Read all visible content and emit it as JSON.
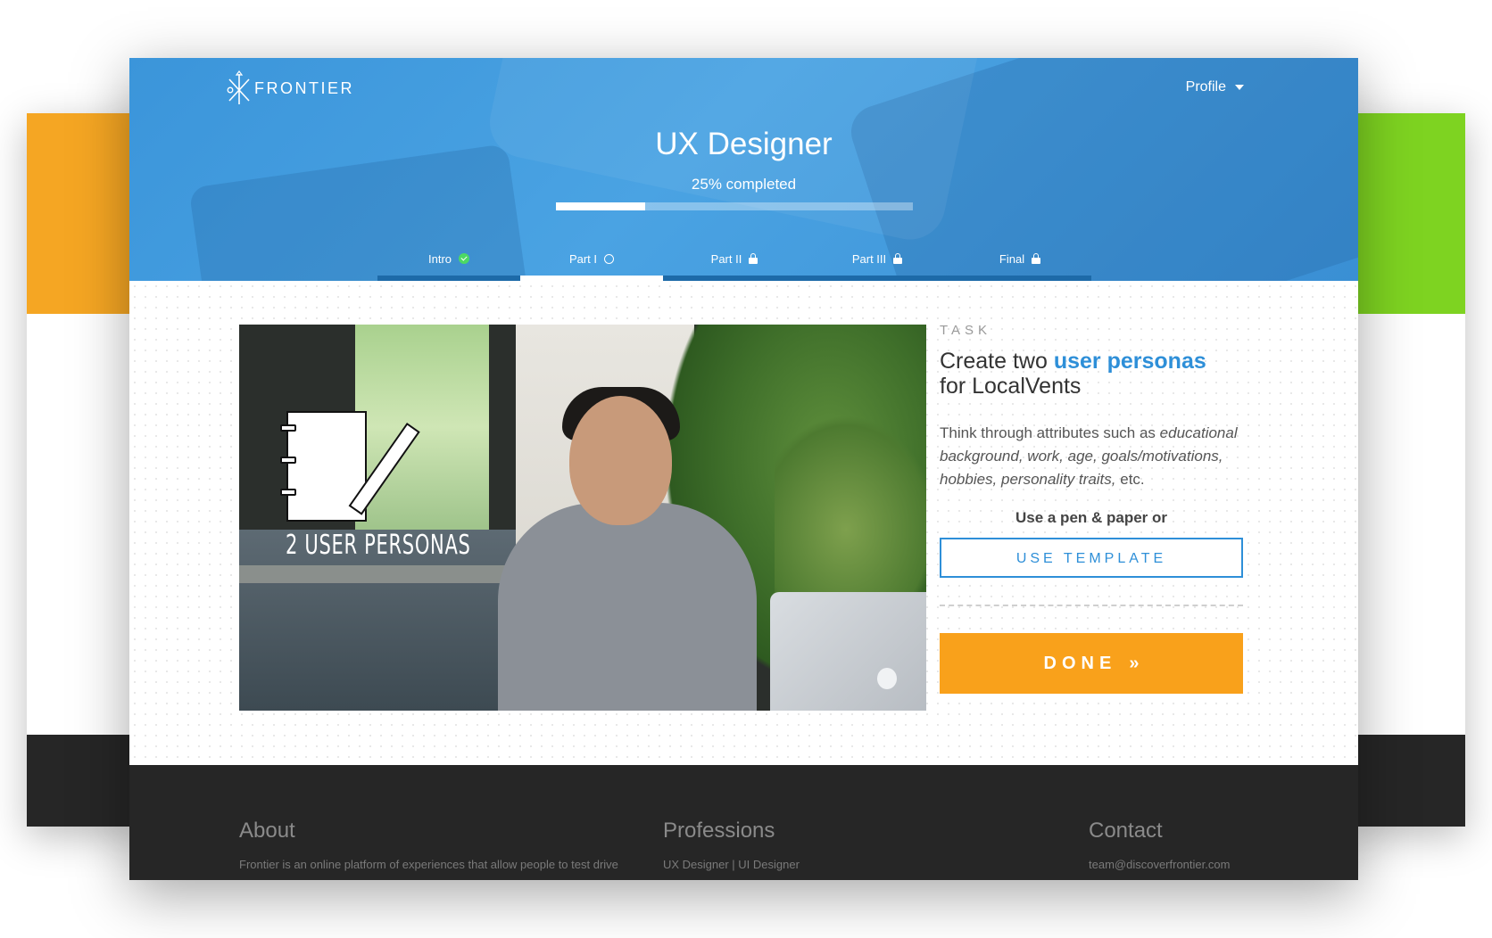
{
  "brand": {
    "name": "FRONTIER"
  },
  "header": {
    "profile_label": "Profile",
    "title": "UX Designer",
    "progress_label": "25% completed",
    "progress_fraction": 0.25
  },
  "steps": [
    {
      "label": "Intro",
      "status": "complete",
      "icon": "check-circle-icon"
    },
    {
      "label": "Part I",
      "status": "active",
      "icon": "circle-icon"
    },
    {
      "label": "Part II",
      "status": "locked",
      "icon": "lock-icon"
    },
    {
      "label": "Part III",
      "status": "locked",
      "icon": "lock-icon"
    },
    {
      "label": "Final",
      "status": "locked",
      "icon": "lock-icon"
    }
  ],
  "video": {
    "caption": "2 USER PERSONAS"
  },
  "task": {
    "label": "TASK",
    "heading_prefix": "Create two",
    "heading_highlight": "user personas",
    "heading_suffix": "for LocalVents",
    "desc_prefix": "Think through attributes such as",
    "desc_italic": "educational background, work, age, goals/motivations, hobbies, personality traits,",
    "desc_suffix": "etc.",
    "pen_paper": "Use a pen & paper or",
    "template_button": "USE TEMPLATE",
    "done_button": "DONE",
    "done_icon": "»"
  },
  "footer": {
    "about": {
      "title": "About",
      "text": "Frontier is an online platform of experiences that allow people to test drive"
    },
    "professions": {
      "title": "Professions",
      "text": "UX Designer | UI Designer"
    },
    "contact": {
      "title": "Contact",
      "text": "team@discoverfrontier.com"
    }
  },
  "colors": {
    "header_blue": "#3b95da",
    "accent_blue": "#2e8fd8",
    "done_orange": "#f9a11b",
    "check_green": "#4cd964",
    "left_card": "#f5a623",
    "right_card": "#7ed321",
    "footer_bg": "#262626"
  }
}
